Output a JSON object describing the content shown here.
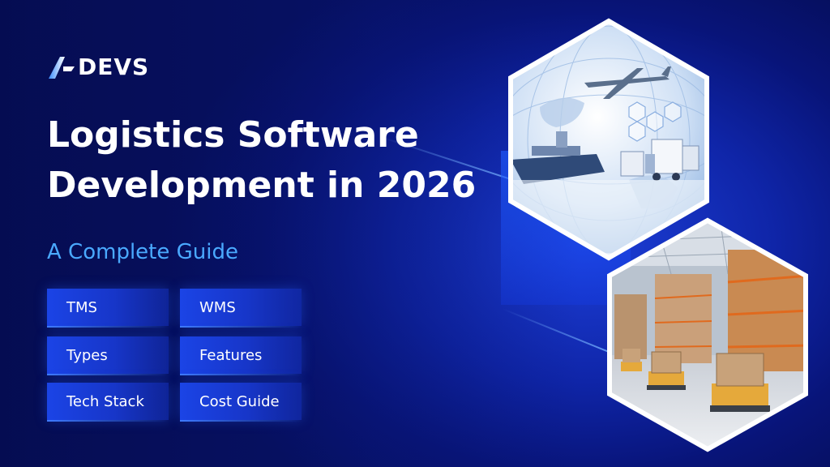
{
  "brand": {
    "logo_text": "DEVS"
  },
  "headline": {
    "line1": "Logistics Software",
    "line2": "Development in 2026"
  },
  "subtitle": "A Complete Guide",
  "topics": [
    {
      "label": "TMS"
    },
    {
      "label": "WMS"
    },
    {
      "label": "Types"
    },
    {
      "label": "Features"
    },
    {
      "label": "Tech Stack"
    },
    {
      "label": "Cost Guide"
    }
  ],
  "images": {
    "top": "globe-cargo-plane-ship-trucks-image",
    "bottom": "warehouse-robots-image"
  },
  "colors": {
    "background": "#0b1a8f",
    "accent": "#4aa9ff",
    "chip": "#1b44e6",
    "text": "#ffffff"
  }
}
